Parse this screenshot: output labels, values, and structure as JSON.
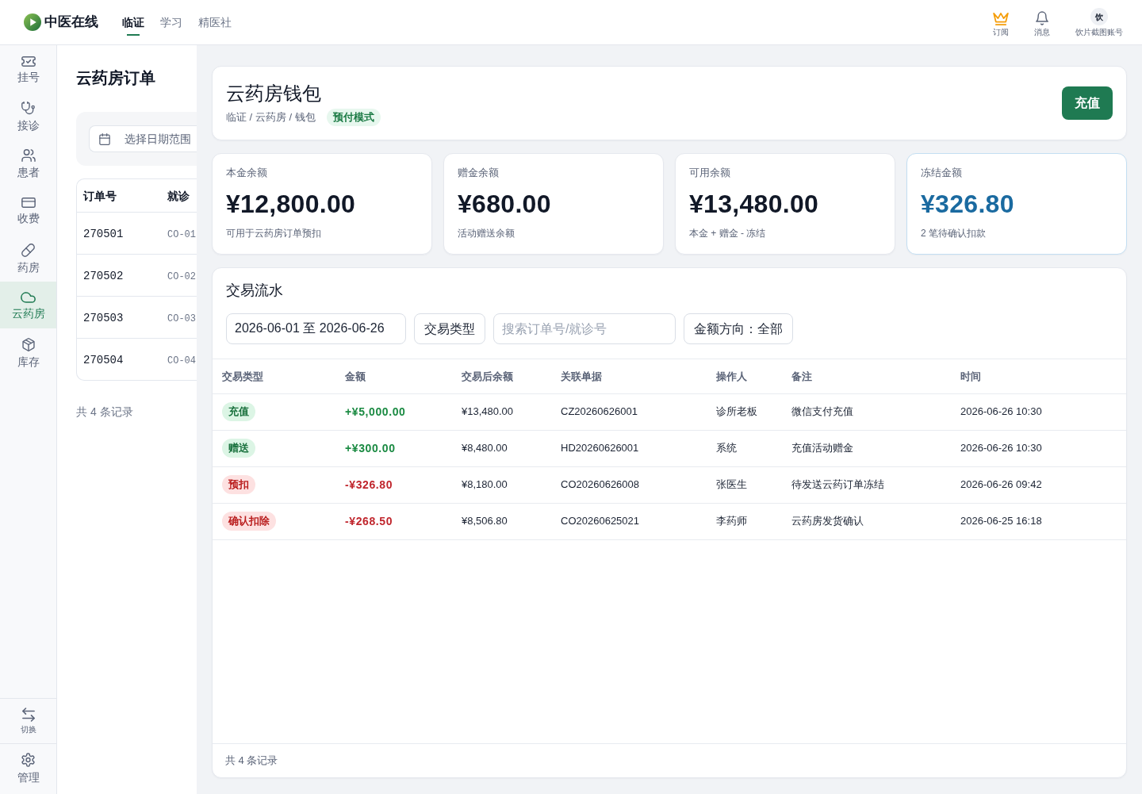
{
  "top_nav": {
    "logo_text": "中医在线",
    "tabs": [
      {
        "label": "临证",
        "selected": true
      },
      {
        "label": "学习",
        "selected": false
      },
      {
        "label": "精医社",
        "selected": false
      }
    ],
    "subscription": {
      "label": "订阅"
    },
    "messages": {
      "label": "消息"
    },
    "account": {
      "avatar_text": "饮",
      "label": "饮片截图账号"
    }
  },
  "sidebar": {
    "items": [
      {
        "label": "挂号",
        "selected": false
      },
      {
        "label": "接诊",
        "selected": false
      },
      {
        "label": "患者",
        "selected": false
      },
      {
        "label": "收费",
        "selected": false
      },
      {
        "label": "药房",
        "selected": false
      },
      {
        "label": "云药房",
        "selected": true
      },
      {
        "label": "库存",
        "selected": false
      }
    ],
    "switch": {
      "label": "切换"
    },
    "manage": {
      "label": "管理"
    }
  },
  "order_panel": {
    "title": "云药房订单",
    "date_filter": {
      "placeholder": "选择日期范围"
    },
    "table": {
      "columns": [
        "订单号",
        "就诊"
      ],
      "rows": [
        [
          "270501",
          "CO-01"
        ],
        [
          "270502",
          "CO-02"
        ],
        [
          "270503",
          "CO-03"
        ],
        [
          "270504",
          "CO-04"
        ]
      ]
    },
    "footer": "共 4 条记录"
  },
  "wallet_header": {
    "title": "云药房钱包",
    "breadcrumb": "临证 / 云药房 / 钱包",
    "mode_tag": "预付模式",
    "recharge_button": "充值"
  },
  "balance_cards": [
    {
      "kind": "standard",
      "label": "本金余额",
      "amount": "¥12,800.00",
      "note": "可用于云药房订单预扣"
    },
    {
      "kind": "standard",
      "label": "赠金余额",
      "amount": "¥680.00",
      "note": "活动赠送余额"
    },
    {
      "kind": "standard",
      "label": "可用余额",
      "amount": "¥13,480.00",
      "note": "本金 + 赠金 - 冻结"
    },
    {
      "kind": "frozen",
      "label": "冻结金额",
      "amount": "¥326.80",
      "note": "2 笔待确认扣款"
    }
  ],
  "transactions": {
    "title": "交易流水",
    "filters": {
      "date_range": {
        "value": "2026-06-01 至 2026-06-26"
      },
      "type_button": "交易类型",
      "search": {
        "placeholder": "搜索订单号/就诊号"
      },
      "direction_button": "金额方向：全部"
    },
    "table": {
      "columns": [
        "交易类型",
        "金额",
        "交易后余额",
        "关联单据",
        "操作人",
        "备注",
        "时间"
      ],
      "rows": [
        {
          "kind": "credit",
          "type": "充值",
          "amount": "+¥5,000.00",
          "balance_after": "¥13,480.00",
          "reference": "CZ20260626001",
          "operator": "诊所老板",
          "note": "微信支付充值",
          "time": "2026-06-26 10:30"
        },
        {
          "kind": "credit",
          "type": "赠送",
          "amount": "+¥300.00",
          "balance_after": "¥8,480.00",
          "reference": "HD20260626001",
          "operator": "系统",
          "note": "充值活动赠金",
          "time": "2026-06-26 10:30"
        },
        {
          "kind": "debit",
          "type": "预扣",
          "amount": "-¥326.80",
          "balance_after": "¥8,180.00",
          "reference": "CO20260626008",
          "operator": "张医生",
          "note": "待发送云药订单冻结",
          "time": "2026-06-26 09:42"
        },
        {
          "kind": "debit",
          "type": "确认扣除",
          "amount": "-¥268.50",
          "balance_after": "¥8,506.80",
          "reference": "CO20260625021",
          "operator": "李药师",
          "note": "云药房发货确认",
          "time": "2026-06-25 16:18"
        }
      ]
    },
    "footer": "共 4 条记录"
  }
}
